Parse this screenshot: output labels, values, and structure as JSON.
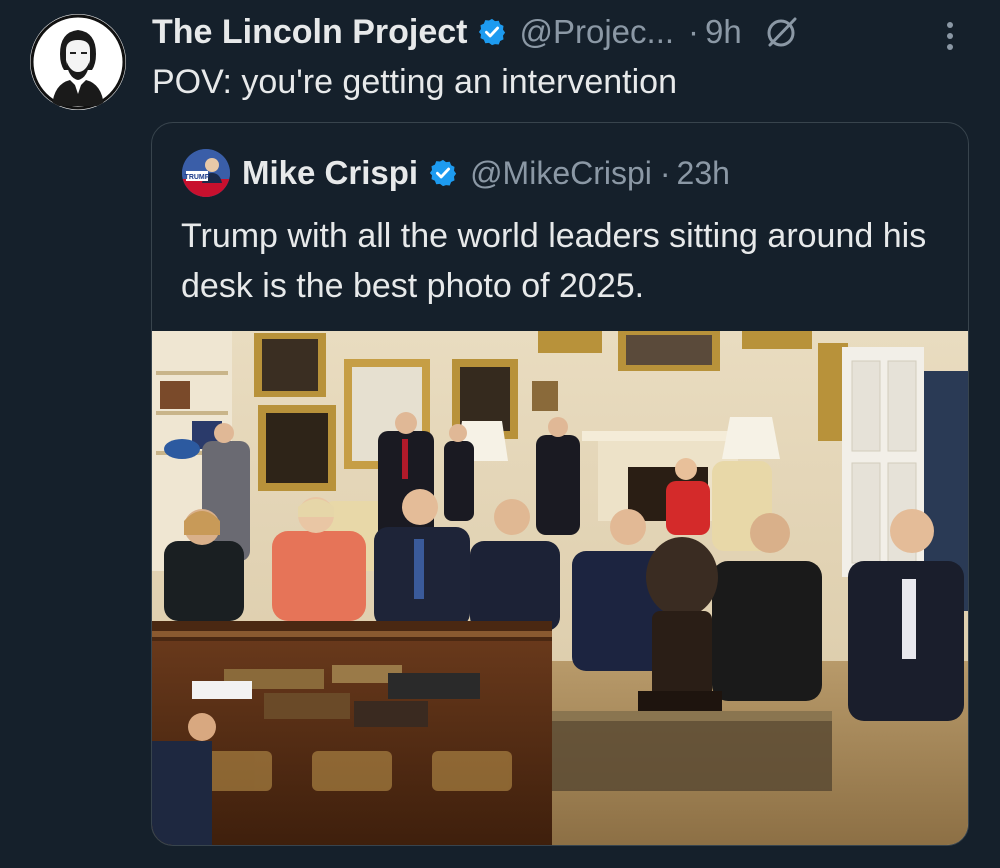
{
  "tweet": {
    "author_name": "The Lincoln Project",
    "author_handle": "@Projec...",
    "separator": "·",
    "time": "9h",
    "text": "POV: you're getting an intervention",
    "avatar_icon": "lincoln-portrait-icon",
    "verified_icon": "verified-badge-icon",
    "grok_icon": "grok-icon",
    "more_icon": "more-options-icon"
  },
  "quoted_tweet": {
    "author_name": "Mike Crispi",
    "author_handle": "@MikeCrispi",
    "separator": "·",
    "time": "23h",
    "text": "Trump with all the world leaders sitting around his desk is the best photo of 2025.",
    "avatar_icon": "profile-photo-icon",
    "avatar_badge_text": "TRUMP",
    "verified_icon": "verified-badge-icon",
    "media": {
      "type": "photo",
      "icon": "oval-office-photo"
    }
  },
  "colors": {
    "background": "#15202b",
    "primary_text": "#e7e9ea",
    "secondary_text": "#8b98a5",
    "verified_blue": "#1d9bf0",
    "border": "#38444d"
  }
}
